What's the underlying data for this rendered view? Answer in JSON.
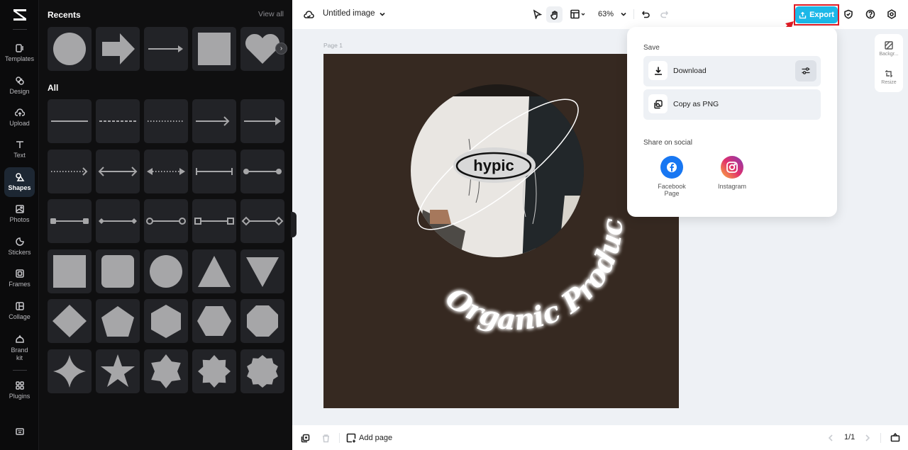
{
  "rail": {
    "items": [
      {
        "label": "Templates",
        "icon": "templates-icon"
      },
      {
        "label": "Design",
        "icon": "design-icon"
      },
      {
        "label": "Upload",
        "icon": "upload-icon"
      },
      {
        "label": "Text",
        "icon": "text-icon"
      },
      {
        "label": "Shapes",
        "icon": "shapes-icon",
        "active": true
      },
      {
        "label": "Photos",
        "icon": "photos-icon"
      },
      {
        "label": "Stickers",
        "icon": "stickers-icon"
      },
      {
        "label": "Frames",
        "icon": "frames-icon"
      },
      {
        "label": "Collage",
        "icon": "collage-icon"
      },
      {
        "label": "Brand kit",
        "icon": "brand-kit-icon"
      },
      {
        "label": "Plugins",
        "icon": "plugins-icon"
      }
    ],
    "bottom_icon": "keyboard-shortcuts-icon"
  },
  "panel": {
    "recents_title": "Recents",
    "view_all": "View all",
    "all_title": "All",
    "recents": [
      "circle",
      "block-arrow",
      "arrow-line",
      "square",
      "heart"
    ],
    "all_shapes": [
      "line",
      "dashed-line",
      "dotted-line",
      "arrow-line",
      "arrow-line-filled",
      "dotted-arrow",
      "double-arrow",
      "dotted-double-arrow-filled",
      "bar-ends-line",
      "dot-ends-line",
      "square-ends-line",
      "diamond-ends-line",
      "circle-outline-ends-line",
      "square-outline-ends-line",
      "diamond-outline-ends-line",
      "square",
      "rounded-square",
      "circle",
      "triangle",
      "inverted-triangle",
      "diamond",
      "pentagon",
      "hexagon",
      "hexagon-flat",
      "octagon",
      "four-point-star",
      "five-point-star",
      "six-point-star",
      "eight-point-star",
      "ten-point-star"
    ]
  },
  "topbar": {
    "title": "Untitled image",
    "zoom": "63%",
    "export_label": "Export"
  },
  "canvas": {
    "page_label": "Page 1",
    "logo_text": "hypic",
    "curved_text": "Organic Product",
    "background_color": "#362921"
  },
  "export_popup": {
    "save_title": "Save",
    "download_label": "Download",
    "copy_label": "Copy as PNG",
    "share_title": "Share on social",
    "social": [
      {
        "label": "Facebook Page",
        "color": "#1877f2"
      },
      {
        "label": "Instagram",
        "color": "#e1306c"
      }
    ]
  },
  "right_tools": [
    {
      "label": "Backgr..."
    },
    {
      "label": "Resize"
    }
  ],
  "bottombar": {
    "add_page": "Add page",
    "pagination": "1/1"
  },
  "colors": {
    "accent": "#1cb8e8",
    "highlight": "#e01b24"
  }
}
